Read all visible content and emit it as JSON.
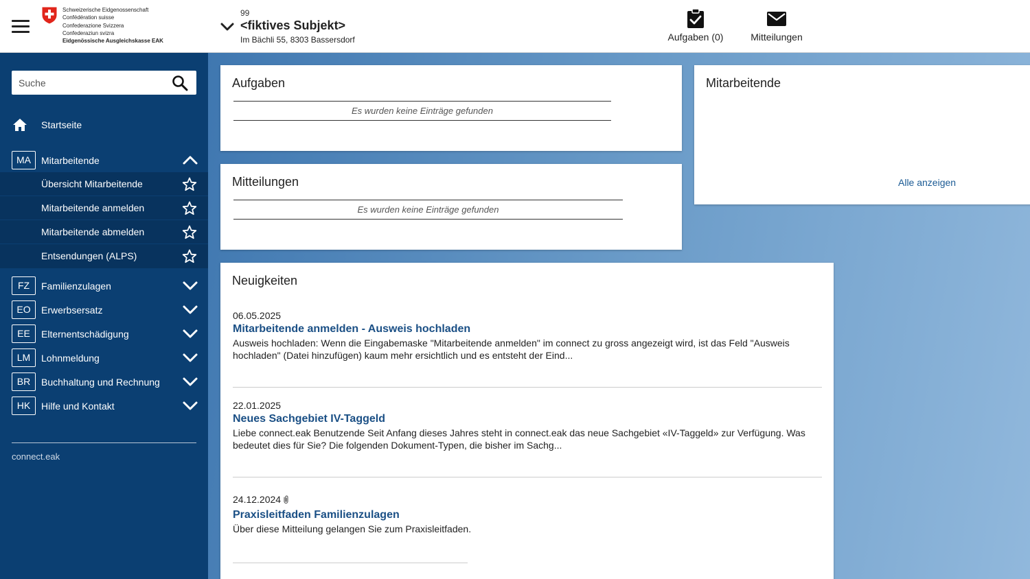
{
  "logo": {
    "lines": [
      "Schweizerische Eidgenossenschaft",
      "Confédération suisse",
      "Confederazione Svizzera",
      "Confederaziun svizra",
      "Eidgenössische Ausgleichskasse EAK"
    ]
  },
  "subject": {
    "number": "99",
    "name": "<fiktives Subjekt>",
    "address": "Im Bächli 55, 8303 Bassersdorf"
  },
  "header_actions": {
    "tasks_label": "Aufgaben (0)",
    "messages_label": "Mitteilungen"
  },
  "sidebar": {
    "search_placeholder": "Suche",
    "home_label": "Startseite",
    "groups": [
      {
        "badge": "MA",
        "label": "Mitarbeitende",
        "expanded": true
      },
      {
        "badge": "FZ",
        "label": "Familienzulagen"
      },
      {
        "badge": "EO",
        "label": "Erwerbsersatz"
      },
      {
        "badge": "EE",
        "label": "Elternentschädigung"
      },
      {
        "badge": "LM",
        "label": "Lohnmeldung"
      },
      {
        "badge": "BR",
        "label": "Buchhaltung und Rechnung"
      },
      {
        "badge": "HK",
        "label": "Hilfe und Kontakt"
      }
    ],
    "ma_items": [
      "Übersicht Mitarbeitende",
      "Mitarbeitende anmelden",
      "Mitarbeitende abmelden",
      "Entsendungen (ALPS)"
    ],
    "footer": "connect.eak"
  },
  "cards": {
    "aufgaben": {
      "title": "Aufgaben",
      "empty": "Es wurden keine Einträge gefunden"
    },
    "mitteilungen": {
      "title": "Mitteilungen",
      "empty": "Es wurden keine Einträge gefunden"
    },
    "mitarbeitende": {
      "title": "Mitarbeitende",
      "show_all": "Alle anzeigen"
    },
    "neuigkeiten": {
      "title": "Neuigkeiten",
      "items": [
        {
          "date": "06.05.2025",
          "title": "Mitarbeitende anmelden - Ausweis hochladen",
          "text": "Ausweis hochladen: Wenn die Eingabemaske \"Mitarbeitende anmelden\" im connect zu gross angezeigt wird, ist das Feld \"Ausweis hochladen\" (Datei hinzufügen) kaum mehr ersichtlich und es entsteht der Eind..."
        },
        {
          "date": "22.01.2025",
          "title": "Neues Sachgebiet IV-Taggeld",
          "text": "Liebe connect.eak Benutzende Seit Anfang dieses Jahres steht in connect.eak das neue Sachgebiet «IV-Taggeld» zur Verfügung. Was bedeutet dies für Sie? Die folgenden Dokument-Typen, die bisher im Sachg..."
        },
        {
          "date": "24.12.2024",
          "title": "Praxisleitfaden Familienzulagen",
          "text": "Über diese Mitteilung gelangen Sie zum Praxisleitfaden."
        }
      ]
    }
  },
  "colors": {
    "sidebar": "#0b3f72",
    "sidebar_sub": "#08335e",
    "link": "#1a4f85",
    "swiss_red": "#e1251b"
  }
}
